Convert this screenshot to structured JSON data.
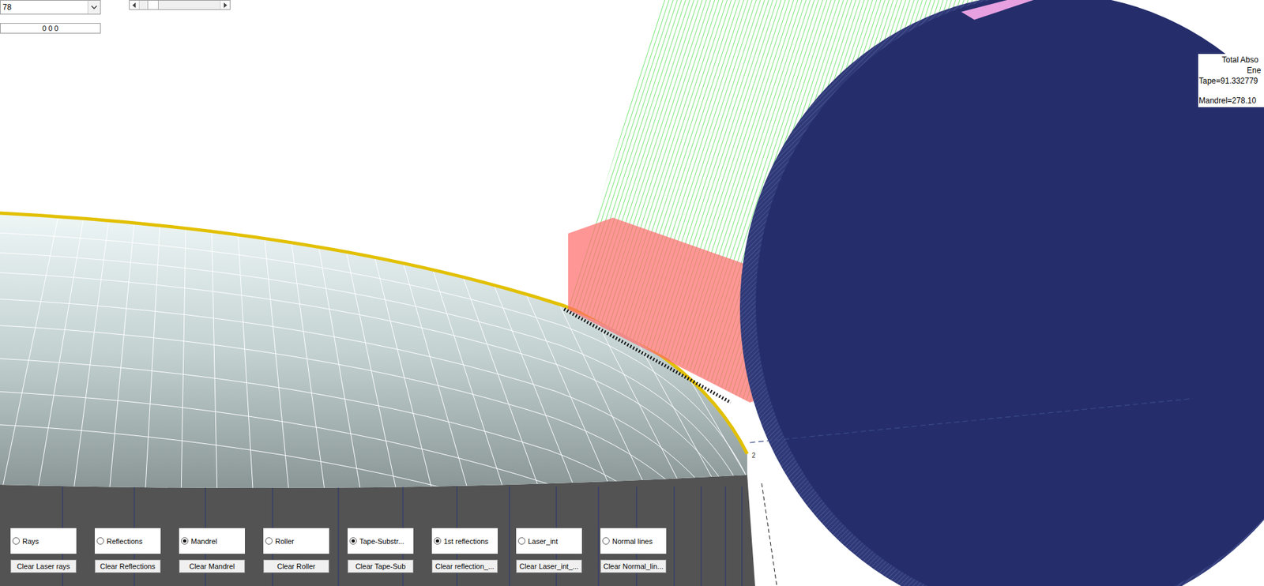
{
  "controls": {
    "dropdown": {
      "value": "78"
    },
    "text_field": {
      "value": "0 0 0"
    },
    "slider": {
      "level": 0.1
    }
  },
  "energy_panel": {
    "lines": [
      "Total Abso",
      "Ene",
      "Tape=91.332779",
      "Mandrel=278.10"
    ]
  },
  "scene": {
    "axis_label": "2"
  },
  "toggles": [
    {
      "label": "Rays",
      "selected": false,
      "button": "Clear Laser rays"
    },
    {
      "label": "Reflections",
      "selected": false,
      "button": "Clear Reflections"
    },
    {
      "label": "Mandrel",
      "selected": true,
      "button": "Clear Mandrel"
    },
    {
      "label": "Roller",
      "selected": false,
      "button": "Clear Roller"
    },
    {
      "label": "Tape-Substr...",
      "selected": true,
      "button": "Clear Tape-Sub"
    },
    {
      "label": "1st reflections",
      "selected": true,
      "button": "Clear reflection_..."
    },
    {
      "label": "Laser_int",
      "selected": false,
      "button": "Clear Laser_int_..."
    },
    {
      "label": "Normal lines",
      "selected": false,
      "button": "Clear Normal_lin..."
    }
  ]
}
